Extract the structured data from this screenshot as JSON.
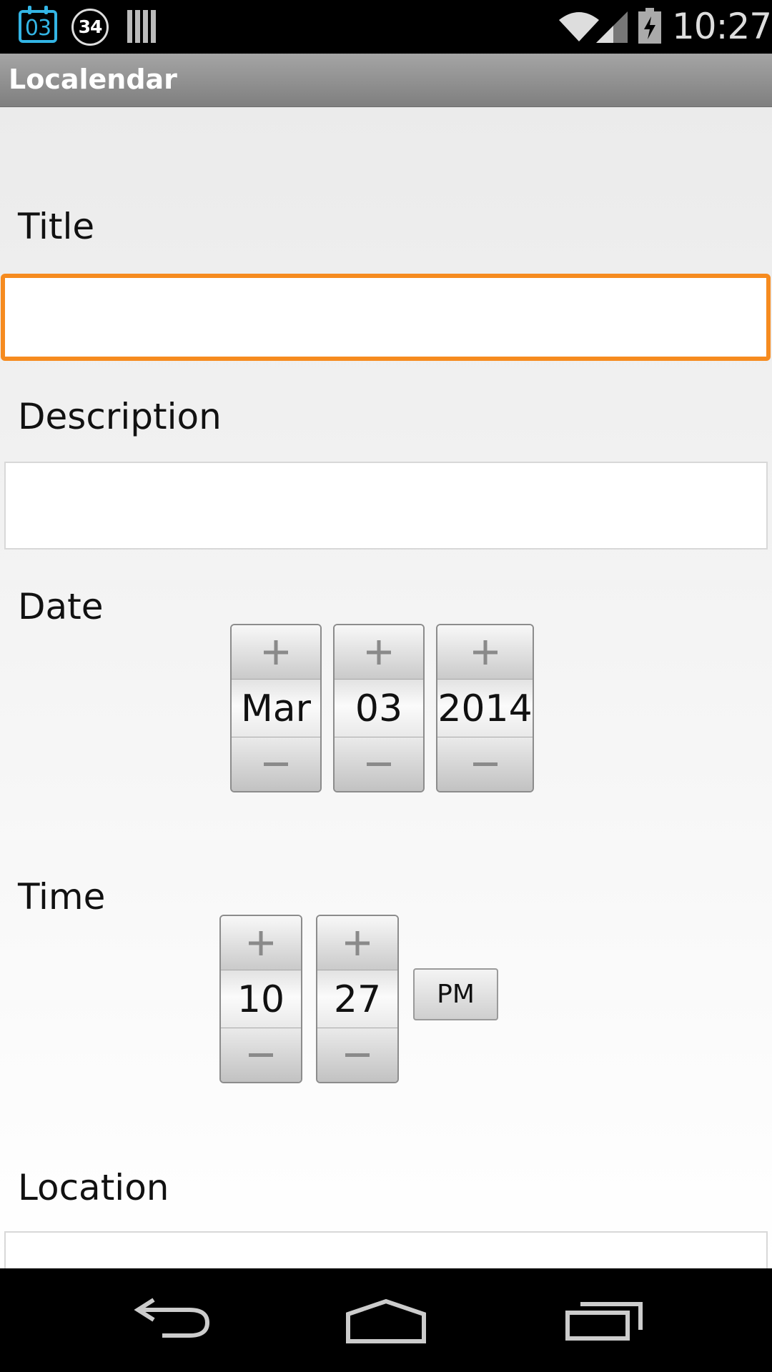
{
  "status_bar": {
    "calendar_notification": "03",
    "badge_count": "34",
    "time": "10:27",
    "icons": [
      "calendar-icon",
      "count-badge-icon",
      "barcode-icon",
      "wifi-icon",
      "signal-icon",
      "battery-charging-icon"
    ]
  },
  "app_bar": {
    "title": "Localendar"
  },
  "form": {
    "title_label": "Title",
    "title_value": "",
    "description_label": "Description",
    "description_value": "",
    "date_label": "Date",
    "date": {
      "month": "Mar",
      "day": "03",
      "year": "2014"
    },
    "time_label": "Time",
    "time": {
      "hour": "10",
      "minute": "27",
      "ampm": "PM"
    },
    "location_label": "Location",
    "location_value": ""
  },
  "colors": {
    "focus_border": "#f68b1f",
    "status_accent": "#33b5e5",
    "action_bar": "#8f8f8f"
  },
  "nav_bar": {
    "icons": [
      "back-icon",
      "home-icon",
      "recent-apps-icon"
    ]
  }
}
